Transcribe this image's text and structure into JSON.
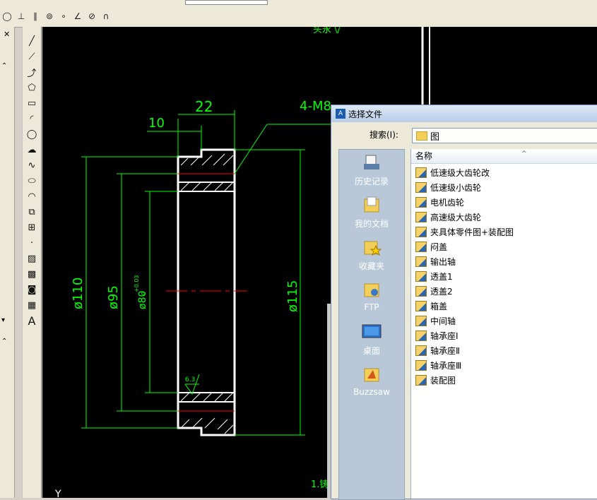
{
  "toolbar": {
    "icons": [
      "circle-icon",
      "perpendicular-icon",
      "parallel-icon",
      "snap-icon",
      "node-icon",
      "angle-icon",
      "no-snap-icon",
      "osnap-icon"
    ]
  },
  "drawing": {
    "dim_22": "22",
    "dim_10": "10",
    "dim_4m8": "4-M8",
    "dim_d110": "ø110",
    "dim_d95": "ø95",
    "dim_d80": "ø80",
    "dim_d80_tol_upper": "+0.03",
    "dim_d80_tol_lower": "0",
    "dim_d115": "ø115",
    "roughness": "6.3",
    "note_1": "1.铸",
    "top_fragment": "头永 \\/",
    "axis_y": "Y"
  },
  "dialog": {
    "title": "选择文件",
    "search_label": "搜索(I):",
    "search_value": "图",
    "column_name": "名称",
    "places": [
      "历史记录",
      "我的文档",
      "收藏夹",
      "FTP",
      "桌面",
      "Buzzsaw"
    ],
    "files": [
      "低速级大齿轮改",
      "低速级小齿轮",
      "电机齿轮",
      "高速级大齿轮",
      "夹具体零件图+装配图",
      "闷盖",
      "输出轴",
      "透盖1",
      "透盖2",
      "箱盖",
      "中间轴",
      "轴承座Ⅰ",
      "轴承座Ⅱ",
      "轴承座Ⅲ",
      "装配图"
    ]
  },
  "colors": {
    "canvas": "#000000",
    "dimension": "#00ff00",
    "geometry": "#ffffff",
    "centerline": "#ff0000"
  }
}
